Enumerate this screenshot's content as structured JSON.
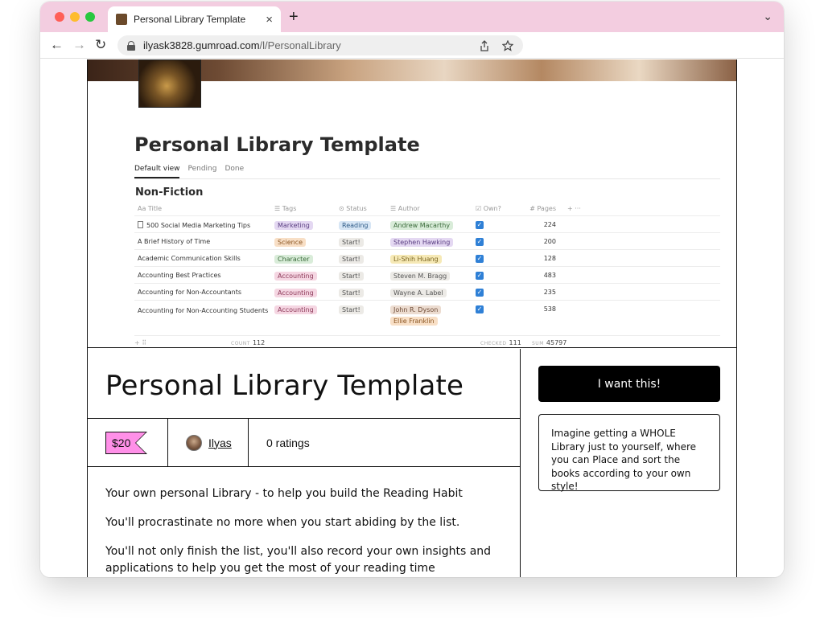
{
  "browser": {
    "tab_title": "Personal Library Template",
    "tab_close": "×",
    "new_tab": "+",
    "tab_menu": "⌄",
    "url_host": "ilyask3828.gumroad.com",
    "url_path": "/l/PersonalLibrary",
    "nav_back": "←",
    "nav_forward": "→",
    "nav_reload": "↻",
    "share_icon": "share-icon",
    "star_icon": "star-icon"
  },
  "notion": {
    "title": "Personal Library Template",
    "views": [
      "Default view",
      "Pending",
      "Done"
    ],
    "section": "Non-Fiction",
    "columns": {
      "title": "Aa Title",
      "tags": "☰ Tags",
      "status": "⊙ Status",
      "author": "☰ Author",
      "own": "☑ Own?",
      "pages": "# Pages",
      "add": "+",
      "more": "···"
    },
    "rows": [
      {
        "title": "500 Social Media Marketing Tips",
        "tag": "Marketing",
        "status": "Reading",
        "authors": [
          "Andrew Macarthy"
        ],
        "pages": "224"
      },
      {
        "title": "A Brief History of Time",
        "tag": "Science",
        "status": "Start!",
        "authors": [
          "Stephen Hawking"
        ],
        "pages": "200"
      },
      {
        "title": "Academic Communication Skills",
        "tag": "Character",
        "status": "Start!",
        "authors": [
          "Li-Shih Huang"
        ],
        "pages": "128"
      },
      {
        "title": "Accounting Best Practices",
        "tag": "Accounting",
        "status": "Start!",
        "authors": [
          "Steven M. Bragg"
        ],
        "pages": "483"
      },
      {
        "title": "Accounting for Non-Accountants",
        "tag": "Accounting",
        "status": "Start!",
        "authors": [
          "Wayne A. Label"
        ],
        "pages": "235"
      },
      {
        "title": "Accounting for Non-Accounting Students",
        "tag": "Accounting",
        "status": "Start!",
        "authors": [
          "John R. Dyson",
          "Ellie Franklin"
        ],
        "pages": "538"
      }
    ],
    "footer": {
      "add": "+ ⠿",
      "count_label": "COUNT",
      "count_value": "112",
      "checked_label": "CHECKED",
      "checked_value": "111",
      "sum_label": "SUM",
      "sum_value": "45797"
    }
  },
  "product": {
    "title": "Personal Library Template",
    "price": "$20",
    "author": "Ilyas",
    "ratings": "0 ratings",
    "description": [
      "Your own personal Library - to help you build the Reading Habit",
      "You'll procrastinate no more when you start abiding by the list.",
      "You'll not only finish the list, you'll also record your own insights and applications to help you get the most of your reading time"
    ],
    "buy_label": "I want this!",
    "summary": "Imagine getting a WHOLE Library just to yourself, where you can Place and sort the books according to your own style!"
  },
  "colors": {
    "tabbar": "#f3cde0",
    "price_tag": "#ff90e8",
    "buy_button": "#000000",
    "checkbox": "#2f80d6"
  }
}
